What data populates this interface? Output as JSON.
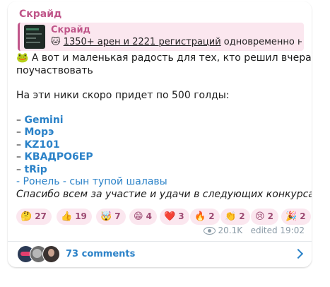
{
  "message": {
    "sender": "Скрайд",
    "reply": {
      "author": "Скрайд",
      "emoji": "🐱",
      "text_underlined": "1350+ арен и 2221 регистраций",
      "text_rest": " одновременно на ..."
    },
    "lines": {
      "l1_emoji": "🐸",
      "l1": "А вот и маленькая радость для тех, кто решил вчера",
      "l2": "поучаствовать",
      "l3": "На эти ники скоро придет по 500 голды:",
      "nick_prefix": "– ",
      "nicks": [
        "Gemini",
        "Морэ",
        "KZ101",
        "КВАДРО6ЕР",
        "tRip"
      ],
      "extra": " - Ронель - сын тупой шалавы",
      "closing": "Спасибо всем за участие и удачи в следующих конкурсах",
      "closing_emoji": "🗿"
    },
    "reactions": [
      {
        "emoji": "🤔",
        "count": "27"
      },
      {
        "emoji": "👍",
        "count": "19"
      },
      {
        "emoji": "🤯",
        "count": "7"
      },
      {
        "emoji": "😁",
        "count": "4"
      },
      {
        "emoji": "❤️",
        "count": "3"
      },
      {
        "emoji": "🔥",
        "count": "2"
      },
      {
        "emoji": "👏",
        "count": "2"
      },
      {
        "emoji": "😢",
        "count": "2"
      },
      {
        "emoji": "🎉",
        "count": "2"
      }
    ],
    "views": "20.1K",
    "edited": "edited 19:02",
    "comments_label": "73 comments"
  }
}
